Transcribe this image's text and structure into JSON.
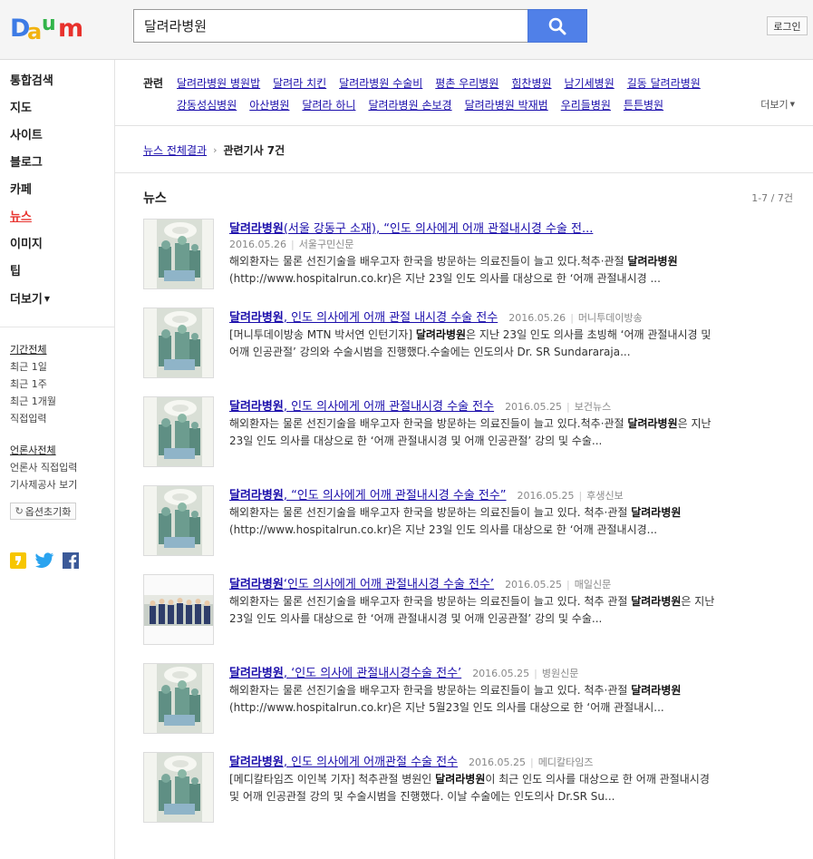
{
  "header": {
    "logo_text": "Daum",
    "search_value": "달려라병원",
    "search_button": "search",
    "login_label": "로그인"
  },
  "sidebar": {
    "nav": [
      {
        "label": "통합검색",
        "active": false
      },
      {
        "label": "지도",
        "active": false
      },
      {
        "label": "사이트",
        "active": false
      },
      {
        "label": "블로그",
        "active": false
      },
      {
        "label": "카페",
        "active": false
      },
      {
        "label": "뉴스",
        "active": true
      },
      {
        "label": "이미지",
        "active": false
      },
      {
        "label": "팁",
        "active": false
      },
      {
        "label": "더보기",
        "active": false
      }
    ],
    "period_filters": [
      "기간전체",
      "최근 1일",
      "최근 1주",
      "최근 1개월",
      "직접입력"
    ],
    "press_filters": [
      "언론사전체",
      "언론사 직접입력",
      "기사제공사 보기"
    ],
    "reset_label": "옵션초기화",
    "share_icons": [
      "kakaostory-icon",
      "twitter-icon",
      "facebook-icon"
    ]
  },
  "related": {
    "label": "관련",
    "line1": [
      "달려라병원 병원밥",
      "달려라 치킨",
      "달려라병원 수술비",
      "평촌 우리병원",
      "힘찬병원",
      "남기세병원",
      "길동 달려라병원"
    ],
    "line2": [
      "강동성심병원",
      "아산병원",
      "달려라 하니",
      "달려라병원 손보경",
      "달려라병원 박재범",
      "우리들병원",
      "튼튼병원"
    ],
    "more_label": "더보기"
  },
  "breadcrumb": {
    "link": "뉴스 전체결과",
    "current": "관련기사 7건"
  },
  "news": {
    "heading": "뉴스",
    "count": "1-7 / 7건",
    "items": [
      {
        "title_bold": "달려라병원",
        "title_rest": "(서울 강동구 소재), “인도 의사에게 어깨 관절내시경 수술 전...",
        "date": "2016.05.26",
        "source": "서울구민신문",
        "meta_below": true,
        "desc1_a": "해외환자는 물론 선진기술을 배우고자 한국을 방문하는 의료진들이 늘고 있다.척추·관절 ",
        "desc1_b": "달려라병원",
        "desc1_c": "",
        "desc2": "(http://www.hospitalrun.co.kr)은 지난 23일 인도 의사를 대상으로 한 ‘어깨 관절내시경 ..."
      },
      {
        "title_bold": "달려라병원",
        "title_rest": ", 인도 의사에게 어깨 관절 내시경 수술 전수",
        "date": "2016.05.26",
        "source": "머니투데이방송",
        "meta_below": false,
        "desc1_a": "[머니투데이방송 MTN 박서연 인턴기자] ",
        "desc1_b": "달려라병원",
        "desc1_c": "은 지난 23일 인도 의사를 초빙해 ‘어깨 관절내시경 및",
        "desc2": "어깨 인공관절’ 강의와 수술시범을 진행했다.수술에는 인도의사 Dr. SR Sundararaja..."
      },
      {
        "title_bold": "달려라병원",
        "title_rest": ", 인도 의사에게 어깨 관절내시경 수술 전수",
        "date": "2016.05.25",
        "source": "보건뉴스",
        "meta_below": false,
        "desc1_a": "해외환자는 물론 선진기술을 배우고자 한국을 방문하는 의료진들이 늘고 있다.척추·관절 ",
        "desc1_b": "달려라병원",
        "desc1_c": "은 지난",
        "desc2": "23일 인도 의사를 대상으로 한 ‘어깨 관절내시경 및 어깨 인공관절’ 강의 및 수술..."
      },
      {
        "title_bold": "달려라병원",
        "title_rest": ", “인도 의사에게 어깨 관절내시경 수술 전수”",
        "date": "2016.05.25",
        "source": "후생신보",
        "meta_below": false,
        "desc1_a": "해외환자는 물론 선진기술을 배우고자 한국을 방문하는 의료진들이 늘고 있다. 척추·관절 ",
        "desc1_b": "달려라병원",
        "desc1_c": "",
        "desc2": "(http://www.hospitalrun.co.kr)은 지난 23일 인도 의사를 대상으로 한 ‘어깨 관절내시경..."
      },
      {
        "title_bold": "달려라병원",
        "title_rest": "‘인도 의사에게 어깨 관절내시경 수술 전수’",
        "date": "2016.05.25",
        "source": "매일신문",
        "meta_below": false,
        "desc1_a": "해외환자는 물론 선진기술을 배우고자 한국을 방문하는 의료진들이 늘고 있다. 척추 관절 ",
        "desc1_b": "달려라병원",
        "desc1_c": "은 지난",
        "desc2": "23일 인도 의사를 대상으로 한 ‘어깨 관절내시경 및 어깨 인공관절’ 강의 및 수술..."
      },
      {
        "title_bold": "달려라병원",
        "title_rest": ", ‘인도 의사에 관절내시경수술 전수’",
        "date": "2016.05.25",
        "source": "병원신문",
        "meta_below": false,
        "desc1_a": "해외환자는 물론 선진기술을 배우고자 한국을 방문하는 의료진들이 늘고 있다. 척추·관절 ",
        "desc1_b": "달려라병원",
        "desc1_c": "",
        "desc2": "(http://www.hospitalrun.co.kr)은 지난 5월23일 인도 의사를 대상으로 한 ‘어깨 관절내시..."
      },
      {
        "title_bold": "달려라병원",
        "title_rest": ", 인도 의사에게 어깨관절 수술 전수",
        "date": "2016.05.25",
        "source": "메디칼타임즈",
        "meta_below": false,
        "desc1_a": "[메디칼타임즈 이인복 기자] 척추관절 병원인 ",
        "desc1_b": "달려라병원",
        "desc1_c": "이 최근 인도 의사를 대상으로 한 어깨 관절내시경",
        "desc2": "및 어깨 인공관절 강의 및 수술시범을 진행했다. 이날 수술에는 인도의사 Dr.SR Su..."
      }
    ]
  },
  "colors": {
    "accent_red": "#e8312c",
    "link_blue": "#1a0dab",
    "search_button": "#5080e8"
  }
}
